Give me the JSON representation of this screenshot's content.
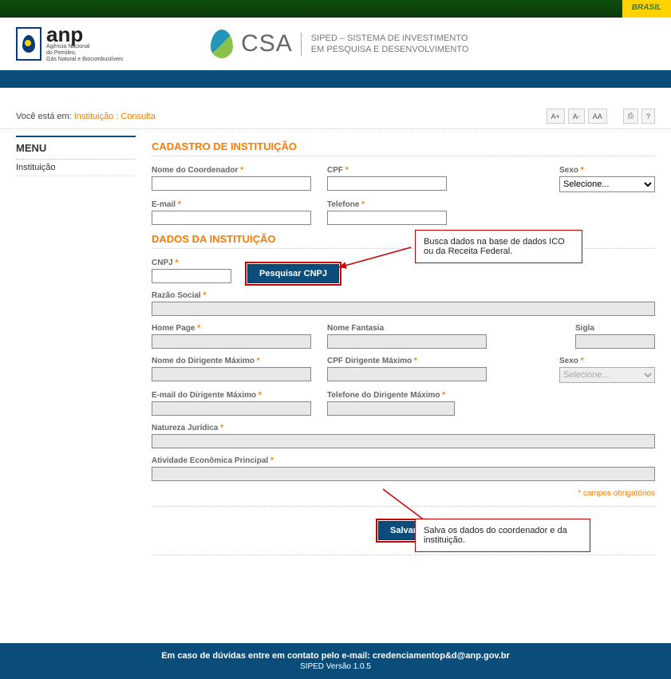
{
  "topbar": {
    "brasil": "BRASIL"
  },
  "header": {
    "anp_name": "anp",
    "anp_sub": "Agência Nacional\ndo Petróleo,\nGás Natural e Biocombustíveis",
    "csa": "CSA",
    "csa_desc1": "SIPED – SISTEMA DE INVESTIMENTO",
    "csa_desc2": "EM PESQUISA E DESENVOLVIMENTO"
  },
  "breadcrumb": {
    "prefix": "Você está em:",
    "a1": "Instituição",
    "sep": ":",
    "a2": "Consulta"
  },
  "tools": {
    "aplus": "A+",
    "aminus": "A-",
    "aa": "AA",
    "print": "⎙",
    "help": "?"
  },
  "menu": {
    "title": "MENU",
    "item1": "Instituição"
  },
  "sections": {
    "cadastro": "CADASTRO DE INSTITUIÇÃO",
    "dados": "DADOS DA INSTITUIÇÃO"
  },
  "labels": {
    "nome_coord": "Nome do Coordenador",
    "cpf": "CPF",
    "sexo": "Sexo",
    "email": "E-mail",
    "telefone": "Telefone",
    "cnpj": "CNPJ",
    "razao": "Razão Social",
    "homepage": "Home Page",
    "nome_fantasia": "Nome Fantasia",
    "sigla": "Sigla",
    "nome_dirigente": "Nome do Dirigente Máximo",
    "cpf_dirigente": "CPF Dirigente Máximo",
    "email_dirigente": "E-mail do Dirigente Máximo",
    "tel_dirigente": "Telefone do Dirigente Máximo",
    "natureza": "Natureza Jurídica",
    "atividade": "Atividade Econômica Principal"
  },
  "select": {
    "placeholder": "Selecione..."
  },
  "buttons": {
    "pesquisar": "Pesquisar CNPJ",
    "salvar": "Salvar"
  },
  "notes": {
    "req": "* campos obrigatórios"
  },
  "callouts": {
    "c1": "Busca dados na base de dados ICO ou da Receita Federal.",
    "c2": "Salva os dados do coordenador e da instituição."
  },
  "footer": {
    "line1": "Em caso de dúvidas entre em contato pelo e-mail: credenciamentop&d@anp.gov.br",
    "line2": "SIPED Versão 1.0.5"
  }
}
